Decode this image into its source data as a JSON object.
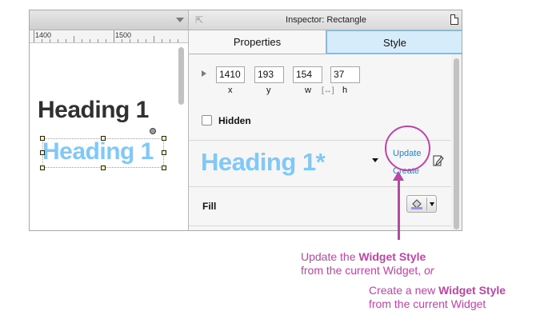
{
  "ruler": {
    "label_1": "1400",
    "label_2": "1500"
  },
  "canvas": {
    "heading_static": "Heading 1",
    "heading_styled": "Heading 1"
  },
  "inspector": {
    "title": "Inspector: Rectangle",
    "tabs": [
      "Properties",
      "Style"
    ],
    "active_tab": "Style",
    "geometry": {
      "x": {
        "value": "1410",
        "label": "x"
      },
      "y": {
        "value": "193",
        "label": "y"
      },
      "w": {
        "value": "154",
        "label": "w"
      },
      "h": {
        "value": "37",
        "label": "h"
      }
    },
    "hidden_label": "Hidden",
    "widget_style": {
      "name": "Heading 1*",
      "update_label": "Update",
      "create_label": "Create"
    },
    "fill_label": "Fill"
  },
  "annotations": {
    "update_prefix": "Update the ",
    "update_bold": "Widget Style",
    "update_line2": "from the current Widget, ",
    "update_or": "or",
    "create_prefix": "Create a new ",
    "create_bold": "Widget Style",
    "create_line2": "from the current Widget"
  },
  "colors": {
    "accent": "#c044a8",
    "style_text": "#7fc8f8",
    "link": "#2f7fc3",
    "tab_active": "#d7ecfb"
  }
}
